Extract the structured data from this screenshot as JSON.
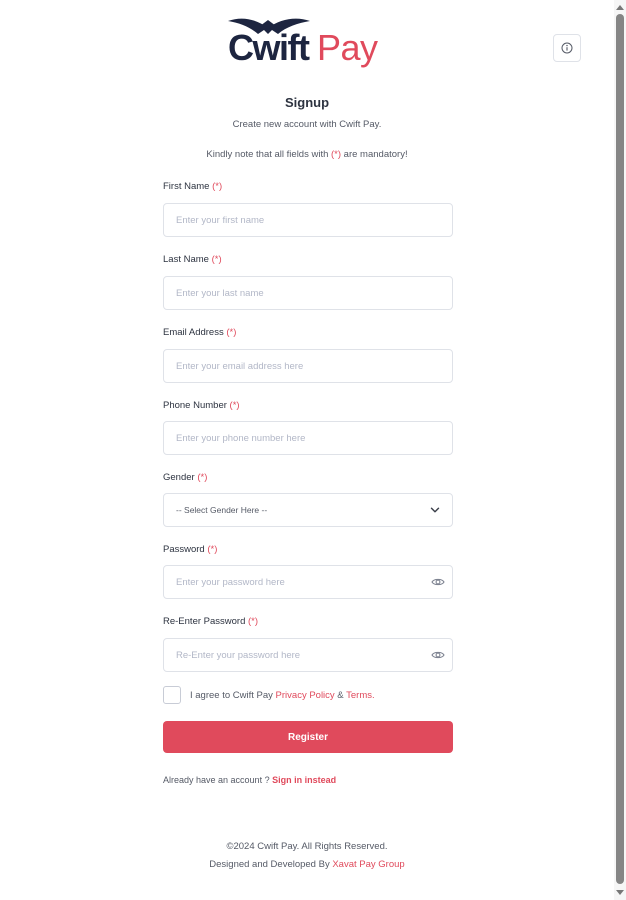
{
  "brand": {
    "logo_main": "Cwift",
    "logo_accent": "Pay",
    "accent_color": "#e04a5c",
    "dark_color": "#1d2540"
  },
  "header": {
    "info_icon": "info-icon",
    "title": "Signup",
    "subtitle": "Create new account with Cwift Pay.",
    "note_prefix": "Kindly note that all fields with ",
    "note_marker": "(*)",
    "note_suffix": " are mandatory!"
  },
  "form": {
    "required_marker": "(*)",
    "first_name": {
      "label": "First Name ",
      "placeholder": "Enter your first name",
      "value": ""
    },
    "last_name": {
      "label": "Last Name ",
      "placeholder": "Enter your last name",
      "value": ""
    },
    "email": {
      "label": "Email Address ",
      "placeholder": "Enter your email address here",
      "value": ""
    },
    "phone": {
      "label": "Phone Number ",
      "placeholder": "Enter your phone number here",
      "value": ""
    },
    "gender": {
      "label": "Gender ",
      "selected": "-- Select Gender Here --"
    },
    "password": {
      "label": "Password ",
      "placeholder": "Enter your password here",
      "value": "",
      "icon": "eye-icon"
    },
    "password_confirm": {
      "label": "Re-Enter Password ",
      "placeholder": "Re-Enter your password here",
      "value": "",
      "icon": "eye-icon"
    },
    "agree": {
      "checked": false,
      "prefix": "I agree to Cwift Pay ",
      "privacy_link": "Privacy Policy",
      "amp": " & ",
      "terms_link": "Terms."
    },
    "register_label": "Register",
    "signin_prefix": "Already have an account ? ",
    "signin_link": "Sign in instead"
  },
  "footer": {
    "copyright": "©2024 Cwift Pay. All Rights Reserved.",
    "designed_prefix": "Designed and Developed By ",
    "designed_link": "Xavat Pay Group"
  }
}
